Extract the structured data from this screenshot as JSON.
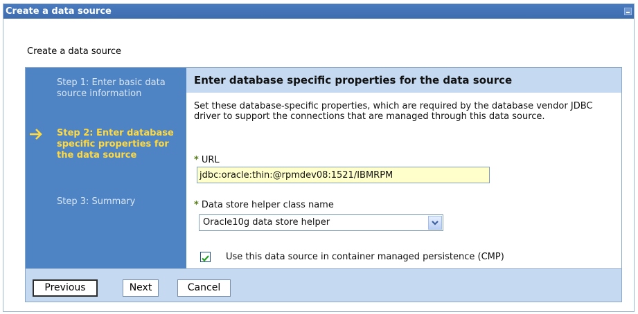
{
  "window": {
    "title": "Create a data source"
  },
  "wizard": {
    "heading": "Create a data source",
    "steps": [
      {
        "label": "Step 1: Enter basic data source information",
        "current": false
      },
      {
        "label": "Step 2: Enter database specific properties for the data source",
        "current": true
      },
      {
        "label": "Step 3: Summary",
        "current": false
      }
    ]
  },
  "content": {
    "header": "Enter database specific properties for the data source",
    "description": "Set these database-specific properties, which are required by the database vendor JDBC driver to support the connections that are managed through this data source.",
    "url_label": "URL",
    "url_value": "jdbc:oracle:thin:@rpmdev08:1521/IBMRPM",
    "helper_label": "Data store helper class name",
    "helper_value": "Oracle10g data store helper",
    "cmp_label": "Use this data source in container managed persistence (CMP)",
    "cmp_checked": true,
    "required_marker": "*"
  },
  "buttons": {
    "previous": "Previous",
    "next": "Next",
    "cancel": "Cancel"
  },
  "colors": {
    "titlebar": "#3d6cae",
    "steps_panel": "#4f84c4",
    "current_step": "#ffd93f",
    "header_band": "#c5d9f0",
    "url_input_bg": "#ffffcc",
    "required_marker": "#5a7f1d"
  },
  "icons": {
    "current_step": "arrow-right-icon",
    "minimize": "minimize-icon",
    "dropdown": "chevron-down-icon",
    "checkbox": "checkmark-icon"
  }
}
